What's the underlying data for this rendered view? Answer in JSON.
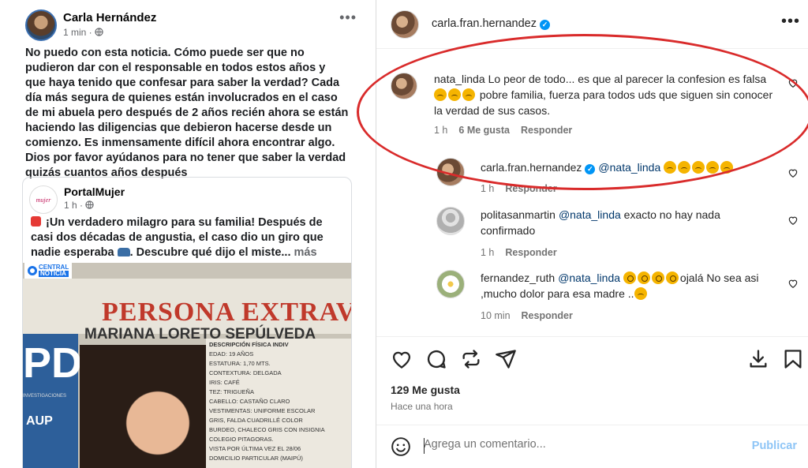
{
  "facebook": {
    "author": "Carla Hernández",
    "time": "1 min · ",
    "text": "No puedo con esta noticia. Cómo puede ser que no pudieron dar con el responsable en todos estos años y que haya tenido que confesar para saber la verdad? Cada día más segura de quienes están involucrados en el caso de mi abuela pero después de 2 años recién ahora se están haciendo las diligencias que debieron hacerse desde un comienzo. Es inmensamente difícil ahora encontrar algo. Dios por favor ayúdanos para no tener que saber la verdad quizás cuantos años después",
    "shared": {
      "logo_text": "mujer",
      "page": "PortalMujer",
      "time": "1 h · ",
      "text_a": "¡Un verdadero milagro para su familia! Después de casi dos décadas de angustia, el caso dio un giro que nadie esperaba ",
      "text_b": ". Descubre qué dijo el miste... ",
      "more": "más",
      "badge_top": "CENTRAL",
      "badge_bottom": "NOTICIA",
      "poster_title": "PERSONA EXTRAVIAD",
      "poster_name": "MARIANA LORETO SEPÚLVEDA",
      "poster_side": "PDI",
      "poster_side_small": "INVESTIGACIONES",
      "poster_side_code": "AUP",
      "poster_info": [
        "DESCRIPCIÓN FÍSICA INDIV",
        "EDAD: 19 AÑOS",
        "ESTATURA: 1,70 MTS.",
        "CONTEXTURA: DELGADA",
        "IRIS: CAFÉ",
        "TEZ: TRIGUEÑA",
        "CABELLO: CASTAÑO CLARO",
        "VESTIMENTAS: UNIFORME ESCOLAR",
        "GRIS, FALDA CUADRILLÉ COLOR",
        "BURDEO, CHALECO GRIS CON INSIGNIA",
        "COLEGIO PITAGORAS.",
        "VISTA POR ÚLTIMA VEZ EL 28/06",
        "DOMICILIO PARTICULAR (MAIPÚ)"
      ]
    }
  },
  "instagram": {
    "post_author": "carla.fran.hernandez",
    "comments": [
      {
        "user": "nata_linda",
        "text": "Lo peor de todo... es que al parecer la confesion es falsa",
        "text_after": " pobre familia, fuerza para todos uds que siguen sin conocer la verdad de sus casos.",
        "time": "1 h",
        "likes": "6 Me gusta",
        "reply": "Responder"
      },
      {
        "user": "carla.fran.hernandez",
        "mention": "@nata_linda",
        "time": "1 h",
        "reply": "Responder"
      },
      {
        "user": "politasanmartin",
        "mention": "@nata_linda",
        "text": " exacto no hay nada confirmado",
        "time": "1 h",
        "reply": "Responder"
      },
      {
        "user": "fernandez_ruth",
        "mention": "@nata_linda",
        "text": "ojalá No sea asi ,mucho dolor para esa madre ..",
        "time": "10 min",
        "reply": "Responder"
      }
    ],
    "likes": "129 Me gusta",
    "posted": "Hace una hora",
    "comment_placeholder": "Agrega un comentario...",
    "publish": "Publicar"
  },
  "colors": {
    "annotation_ellipse": "#d92b2b",
    "verified": "#0095f6",
    "poster_red": "#c0392b",
    "pdi_blue": "#2d5f9a"
  }
}
